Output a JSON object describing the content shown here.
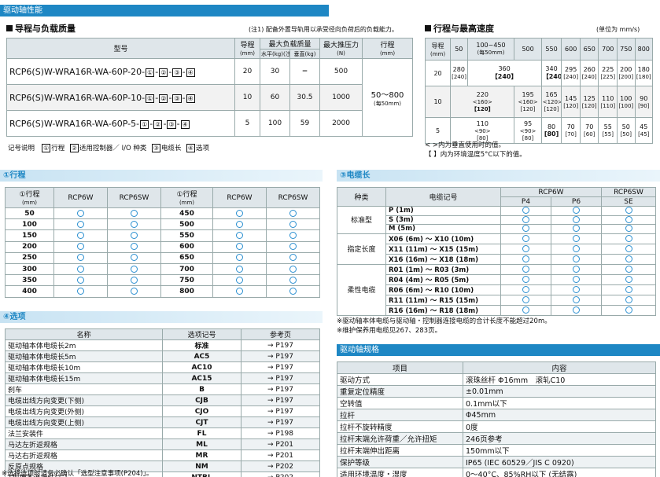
{
  "header": {
    "title": "驱动轴性能"
  },
  "load": {
    "title": "导程与负载质量",
    "note": "(注1) 配备外置导轨用以承受径向负荷后的负载能力。",
    "head": {
      "model": "型号",
      "lead": "导程",
      "lead_unit": "(mm)",
      "max_load": "最大负载质量",
      "horiz": "水平(kg)(注1)",
      "vert": "垂直(kg)",
      "thrust": "最大推压力",
      "thrust_unit": "(N)",
      "stroke": "行程",
      "stroke_unit": "(mm)"
    },
    "rows": [
      {
        "model_prefix": "RCP6(S)W-WRA16R-WA-60P-20-",
        "lead": "20",
        "horiz": "30",
        "vert": "−",
        "thrust": "500"
      },
      {
        "model_prefix": "RCP6(S)W-WRA16R-WA-60P-10-",
        "lead": "10",
        "horiz": "60",
        "vert": "30.5",
        "thrust": "1000"
      },
      {
        "model_prefix": "RCP6(S)W-WRA16R-WA-60P-5-",
        "lead": "5",
        "horiz": "100",
        "vert": "59",
        "thrust": "2000"
      }
    ],
    "code_boxes": [
      "①",
      "②",
      "③",
      "④"
    ],
    "stroke_value": "50～800",
    "stroke_step": "(每50mm)"
  },
  "legend": {
    "label": "记号说明",
    "items": [
      {
        "box": "①",
        "text": "行程"
      },
      {
        "box": "②",
        "text": "适用控制器／ I/O 种类"
      },
      {
        "box": "③",
        "text": "电缆长"
      },
      {
        "box": "④",
        "text": "选项"
      }
    ]
  },
  "speed": {
    "title": "行程与最高速度",
    "unit": "(单位为 mm/s)",
    "head_lead": "导程",
    "head_lead_unit": "(mm)",
    "cols": [
      "50",
      "100~450",
      "500",
      "550",
      "600",
      "650",
      "700",
      "750",
      "800"
    ],
    "col1_sub": "(每50mm)",
    "rows": [
      {
        "lead": "20",
        "cells": [
          [
            "280",
            "[240]"
          ],
          [
            "360",
            "【240】"
          ],
          [
            "340",
            "【240】"
          ],
          [
            "295",
            "[240]"
          ],
          [
            "260",
            "[240]"
          ],
          [
            "225",
            "[225]"
          ],
          [
            "200",
            "[200]"
          ],
          [
            "180",
            "[180]"
          ]
        ]
      },
      {
        "lead": "10",
        "cells": [
          [
            "220",
            "<160>",
            "【120】"
          ],
          [
            "195",
            "<160>",
            "[120]"
          ],
          [
            "165",
            "<120>",
            "[120]"
          ],
          [
            "145",
            "[120]"
          ],
          [
            "125",
            "[120]"
          ],
          [
            "110",
            "[110]"
          ],
          [
            "100",
            "[100]"
          ],
          [
            "90",
            "[90]"
          ]
        ]
      },
      {
        "lead": "5",
        "cells": [
          [
            "110",
            "<90>",
            "[80]"
          ],
          [
            "95",
            "<90>",
            "[80]"
          ],
          [
            "80",
            "[80]"
          ],
          [
            "70",
            "[70]"
          ],
          [
            "70",
            "[60]"
          ],
          [
            "55",
            "[55]"
          ],
          [
            "50",
            "[50]"
          ],
          [
            "45",
            "[45]"
          ]
        ]
      }
    ],
    "note1": "< >内为垂直使用时的值。",
    "note2": "【 】内为环境温度5°C以下的值。"
  },
  "stroke_sec": {
    "title": "①行程",
    "head": {
      "stroke": "①行程",
      "unit": "(mm)",
      "c1": "RCP6W",
      "c2": "RCP6SW"
    },
    "left": [
      "50",
      "100",
      "150",
      "200",
      "250",
      "300",
      "350",
      "400"
    ],
    "right": [
      "450",
      "500",
      "550",
      "600",
      "650",
      "700",
      "750",
      "800"
    ]
  },
  "cable": {
    "title": "③电缆长",
    "head": {
      "type": "种类",
      "code": "电缆记号",
      "rcp6w": "RCP6W",
      "rcp6sw": "RCP6SW",
      "p4": "P4",
      "p6": "P6",
      "se": "SE"
    },
    "groups": [
      {
        "type": "标准型",
        "rows": [
          "P (1m)",
          "S (3m)",
          "M (5m)"
        ]
      },
      {
        "type": "指定长度",
        "rows": [
          "X06 (6m) ～ X10 (10m)",
          "X11 (11m) ～ X15 (15m)",
          "X16 (16m) ～ X18 (18m)"
        ]
      },
      {
        "type": "柔性电缆",
        "rows": [
          "R01 (1m) ～ R03 (3m)",
          "R04 (4m) ～ R05 (5m)",
          "R06 (6m) ～ R10 (10m)",
          "R11 (11m) ～ R15 (15m)",
          "R16 (16m) ～ R18 (18m)"
        ]
      }
    ],
    "note1": "※驱动轴本体电缆与驱动轴・控制器连接电缆的合计长度不能超过20m。",
    "note2": "※维护保养用电缆见267、283页。"
  },
  "options": {
    "title": "④选项",
    "head": {
      "name": "名称",
      "code": "选项记号",
      "page": "参考页"
    },
    "rows": [
      {
        "name": "驱动轴本体电缆长2m",
        "code": "标准",
        "page": "→ P197"
      },
      {
        "name": "驱动轴本体电缆长5m",
        "code": "AC5",
        "page": "→ P197"
      },
      {
        "name": "驱动轴本体电缆长10m",
        "code": "AC10",
        "page": "→ P197"
      },
      {
        "name": "驱动轴本体电缆长15m",
        "code": "AC15",
        "page": "→ P197"
      },
      {
        "name": "刹车",
        "code": "B",
        "page": "→ P197"
      },
      {
        "name": "电缆出线方向变更(下侧)",
        "code": "CJB",
        "page": "→ P197"
      },
      {
        "name": "电缆出线方向变更(外侧)",
        "code": "CJO",
        "page": "→ P197"
      },
      {
        "name": "电缆出线方向变更(上侧)",
        "code": "CJT",
        "page": "→ P197"
      },
      {
        "name": "法兰安装件",
        "code": "FL",
        "page": "→ P198"
      },
      {
        "name": "马达左折返规格",
        "code": "ML",
        "page": "→ P201"
      },
      {
        "name": "马达右折返规格",
        "code": "MR",
        "page": "→ P201"
      },
      {
        "name": "反原点规格",
        "code": "NM",
        "page": "→ P202"
      },
      {
        "name": "T型槽条连接件(左)",
        "code": "NTBL",
        "page": "→ P202"
      },
      {
        "name": "T型槽条连接件(右)",
        "code": "NTBR",
        "page": "→ P202"
      }
    ],
    "note": "※选择选项时请务必确认「选型注意事项(P204)」。"
  },
  "spec": {
    "title": "驱动轴规格",
    "head": {
      "item": "项目",
      "content": "内容"
    },
    "rows": [
      {
        "item": "驱动方式",
        "content": "滚珠丝杆 Φ16mm　滚轧C10"
      },
      {
        "item": "重复定位精度",
        "content": "±0.01mm"
      },
      {
        "item": "空转值",
        "content": "0.1mm以下"
      },
      {
        "item": "拉杆",
        "content": "Φ45mm"
      },
      {
        "item": "拉杆不旋转精度",
        "content": "0度"
      },
      {
        "item": "拉杆末端允许荷重／允许扭矩",
        "content": "246页参考"
      },
      {
        "item": "拉杆末端伸出距离",
        "content": "150mm以下"
      },
      {
        "item": "保护等级",
        "content": "IP65 (IEC 60529／JIS C 0920)"
      },
      {
        "item": "适用环境温度・湿度",
        "content": "0～40°C、85%RH以下 (无结露)"
      }
    ]
  }
}
